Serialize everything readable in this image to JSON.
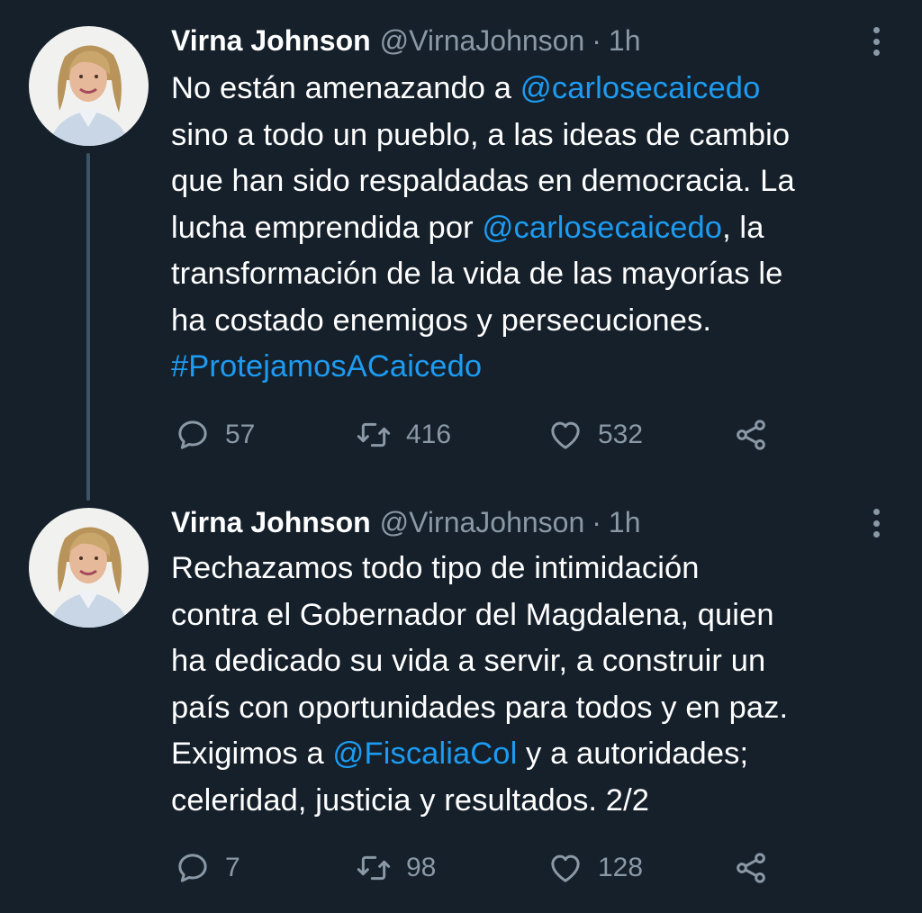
{
  "tweets": [
    {
      "author_name": "Virna Johnson",
      "author_handle": "@VirnaJohnson",
      "separator": "·",
      "time": "1h",
      "body_lines": [
        [
          {
            "t": "No están amenazando a "
          },
          {
            "t": "@carlosecaicedo",
            "link": true
          }
        ],
        [
          {
            "t": "sino a todo un pueblo, a las ideas de cambio"
          }
        ],
        [
          {
            "t": "que han sido respaldadas en democracia. La"
          }
        ],
        [
          {
            "t": "lucha emprendida por "
          },
          {
            "t": "@carlosecaicedo",
            "link": true
          },
          {
            "t": ", la"
          }
        ],
        [
          {
            "t": "transformación de la vida de las mayorías le"
          }
        ],
        [
          {
            "t": "ha costado enemigos y persecuciones."
          }
        ],
        [
          {
            "t": "#ProtejamosACaicedo",
            "link": true
          }
        ]
      ],
      "counts": {
        "replies": "57",
        "retweets": "416",
        "likes": "532"
      }
    },
    {
      "author_name": "Virna Johnson",
      "author_handle": "@VirnaJohnson",
      "separator": "·",
      "time": "1h",
      "body_lines": [
        [
          {
            "t": "Rechazamos todo tipo de intimidación"
          }
        ],
        [
          {
            "t": "contra el Gobernador del Magdalena, quien"
          }
        ],
        [
          {
            "t": "ha dedicado su vida a servir, a construir un"
          }
        ],
        [
          {
            "t": "país con oportunidades para todos y en paz."
          }
        ],
        [
          {
            "t": "Exigimos a "
          },
          {
            "t": "@FiscaliaCol",
            "link": true
          },
          {
            "t": " y a autoridades;"
          }
        ],
        [
          {
            "t": "celeridad, justicia y resultados. 2/2"
          }
        ]
      ],
      "counts": {
        "replies": "7",
        "retweets": "98",
        "likes": "128"
      }
    }
  ],
  "icons": {
    "reply": "reply-icon",
    "retweet": "retweet-icon",
    "like": "heart-icon",
    "share": "share-icon",
    "more": "more-options-icon"
  },
  "colors": {
    "background": "#15202b",
    "text": "#ffffff",
    "secondary": "#8b98a5",
    "link": "#1d9bf0",
    "thread_line": "#3d5466"
  }
}
